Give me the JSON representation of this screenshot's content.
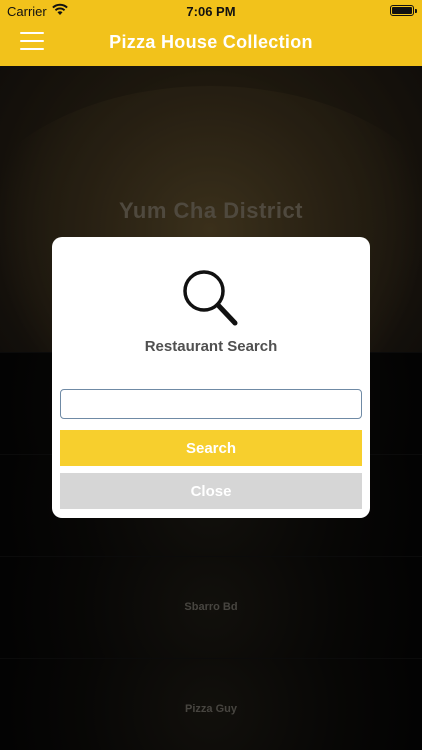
{
  "status_bar": {
    "carrier": "Carrier",
    "time": "7:06 PM"
  },
  "nav": {
    "title": "Pizza House Collection",
    "menu_icon": "hamburger-menu-icon"
  },
  "background": {
    "hero_title": "Yum Cha District",
    "rows": [
      {
        "label": ""
      },
      {
        "label": ""
      },
      {
        "label": "Sbarro Bd"
      },
      {
        "label": "Pizza Guy"
      }
    ]
  },
  "dialog": {
    "icon": "search-icon",
    "heading": "Restaurant Search",
    "input_value": "",
    "input_placeholder": "",
    "search_label": "Search",
    "close_label": "Close"
  },
  "colors": {
    "brand_yellow": "#F2C21B",
    "search_button": "#F7CF2D",
    "close_button": "#D6D6D6"
  }
}
